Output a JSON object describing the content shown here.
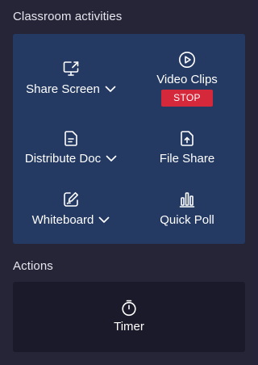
{
  "classroom_activities": {
    "title": "Classroom activities",
    "tiles": [
      {
        "label": "Share Screen",
        "icon": "share-screen-icon",
        "has_dropdown": true
      },
      {
        "label": "Video Clips",
        "icon": "play-circle-icon",
        "has_dropdown": false,
        "stop_label": "STOP"
      },
      {
        "label": "Distribute Doc",
        "icon": "document-icon",
        "has_dropdown": true
      },
      {
        "label": "File Share",
        "icon": "file-upload-icon",
        "has_dropdown": false
      },
      {
        "label": "Whiteboard",
        "icon": "whiteboard-pen-icon",
        "has_dropdown": true
      },
      {
        "label": "Quick Poll",
        "icon": "bar-chart-icon",
        "has_dropdown": false
      }
    ]
  },
  "actions": {
    "title": "Actions",
    "timer_label": "Timer"
  },
  "colors": {
    "background": "#262538",
    "activities_card": "#243a63",
    "actions_card": "#1b1a2b",
    "stop_button": "#d6283b",
    "text": "#ffffff"
  }
}
